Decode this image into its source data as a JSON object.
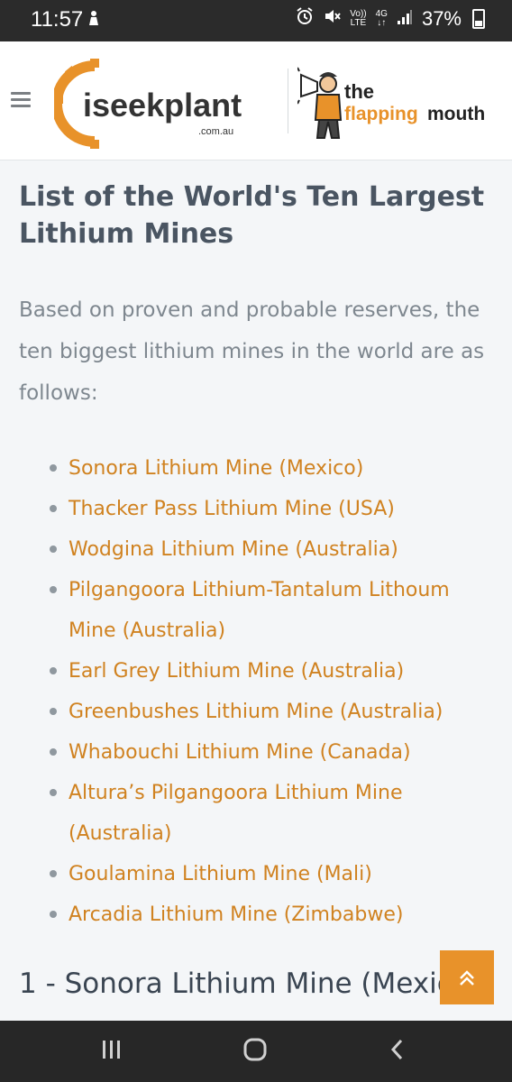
{
  "status_bar": {
    "time": "11:57",
    "signal_label_top": "Vo))",
    "signal_label_bottom": "LTE",
    "network_type": "4G",
    "battery": "37%"
  },
  "header": {
    "logo_main": "iseekplant",
    "logo_sub": ".com.au",
    "partner_logo_line1": "the",
    "partner_logo_line2a": "flapping",
    "partner_logo_line2b": "mouth"
  },
  "article": {
    "heading": "List of the World's Ten Largest Lithium Mines",
    "intro": "Based on proven and probable reserves, the ten biggest lithium mines in the world are as follows:",
    "mines": [
      "Sonora Lithium Mine (Mexico)",
      "Thacker Pass Lithium Mine (USA)",
      "Wodgina Lithium Mine (Australia)",
      "Pilgangoora Lithium-Tantalum Lithoum Mine (Australia)",
      "Earl Grey Lithium Mine (Australia)",
      "Greenbushes Lithium Mine (Australia)",
      "Whabouchi Lithium Mine (Canada)",
      "Altura’s Pilgangoora Lithium Mine (Australia)",
      "Goulamina Lithium Mine (Mali)",
      "Arcadia Lithium Mine (Zimbabwe)"
    ],
    "subheading": "1 - Sonora Lithium Mine (Mexico)"
  },
  "colors": {
    "accent": "#e8922a",
    "link": "#d08220",
    "heading": "#4a5562",
    "body_text": "#7e878f",
    "background": "#f4f6f8"
  },
  "icons": {
    "menu": "hamburger-icon",
    "scroll_top": "double-chevron-up-icon",
    "nav_recent": "recent-apps-icon",
    "nav_home": "home-icon",
    "nav_back": "back-icon"
  }
}
